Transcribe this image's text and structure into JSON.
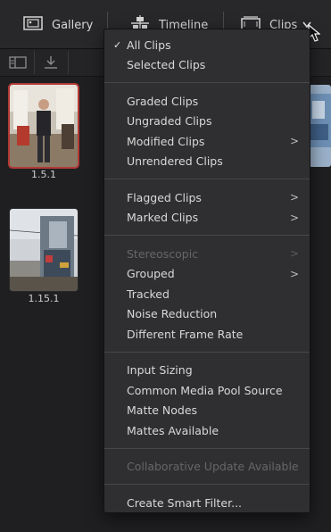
{
  "header": {
    "gallery_label": "Gallery",
    "timeline_label": "Timeline",
    "clips_label": "Clips"
  },
  "thumbnails": [
    {
      "label": "1.5.1",
      "selected": true
    },
    {
      "label": "1.15.1",
      "selected": false
    }
  ],
  "menu": {
    "groups": [
      [
        {
          "label": "All Clips",
          "checked": true,
          "submenu": false,
          "disabled": false
        },
        {
          "label": "Selected Clips",
          "checked": false,
          "submenu": false,
          "disabled": false
        }
      ],
      [
        {
          "label": "Graded Clips",
          "checked": false,
          "submenu": false,
          "disabled": false
        },
        {
          "label": "Ungraded Clips",
          "checked": false,
          "submenu": false,
          "disabled": false
        },
        {
          "label": "Modified Clips",
          "checked": false,
          "submenu": true,
          "disabled": false
        },
        {
          "label": "Unrendered Clips",
          "checked": false,
          "submenu": false,
          "disabled": false
        }
      ],
      [
        {
          "label": "Flagged Clips",
          "checked": false,
          "submenu": true,
          "disabled": false
        },
        {
          "label": "Marked Clips",
          "checked": false,
          "submenu": true,
          "disabled": false
        }
      ],
      [
        {
          "label": "Stereoscopic",
          "checked": false,
          "submenu": true,
          "disabled": true
        },
        {
          "label": "Grouped",
          "checked": false,
          "submenu": true,
          "disabled": false
        },
        {
          "label": "Tracked",
          "checked": false,
          "submenu": false,
          "disabled": false
        },
        {
          "label": "Noise Reduction",
          "checked": false,
          "submenu": false,
          "disabled": false
        },
        {
          "label": "Different Frame Rate",
          "checked": false,
          "submenu": false,
          "disabled": false
        }
      ],
      [
        {
          "label": "Input Sizing",
          "checked": false,
          "submenu": false,
          "disabled": false
        },
        {
          "label": "Common Media Pool Source",
          "checked": false,
          "submenu": false,
          "disabled": false
        },
        {
          "label": "Matte Nodes",
          "checked": false,
          "submenu": false,
          "disabled": false
        },
        {
          "label": "Mattes Available",
          "checked": false,
          "submenu": false,
          "disabled": false
        }
      ],
      [
        {
          "label": "Collaborative Update Available",
          "checked": false,
          "submenu": false,
          "disabled": true
        }
      ],
      [
        {
          "label": "Create Smart Filter...",
          "checked": false,
          "submenu": false,
          "disabled": false
        }
      ]
    ]
  },
  "glyphs": {
    "check": "✓",
    "arrow": ">"
  }
}
